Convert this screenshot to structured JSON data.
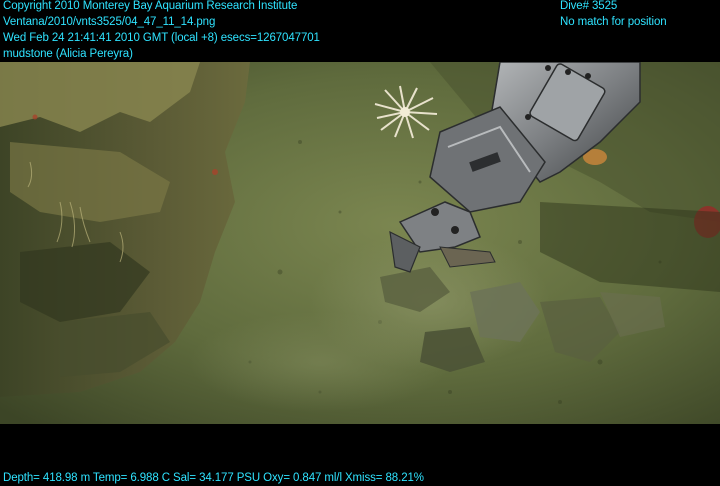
{
  "overlay": {
    "copyright": "Copyright 2010 Monterey Bay Aquarium Research Institute",
    "filename": "Ventana/2010/vnts3525/04_47_11_14.png",
    "datetime": "Wed Feb 24 21:41:41 2010 GMT (local +8)  esecs=1267047701",
    "annotation": "mudstone (Alicia Pereyra)",
    "dive": "Dive# 3525",
    "position_status": "No match for position",
    "telemetry": "Depth= 418.98 m  Temp= 6.988 C  Sal= 34.177 PSU  Oxy= 0.847 ml/l  Xmiss= 88.21%"
  },
  "colors": {
    "overlay_text": "#2fe3ff",
    "seafloor": "#5d6a3c",
    "sediment_dark": "#3b4526",
    "robot_arm": "#8a8d8e"
  }
}
